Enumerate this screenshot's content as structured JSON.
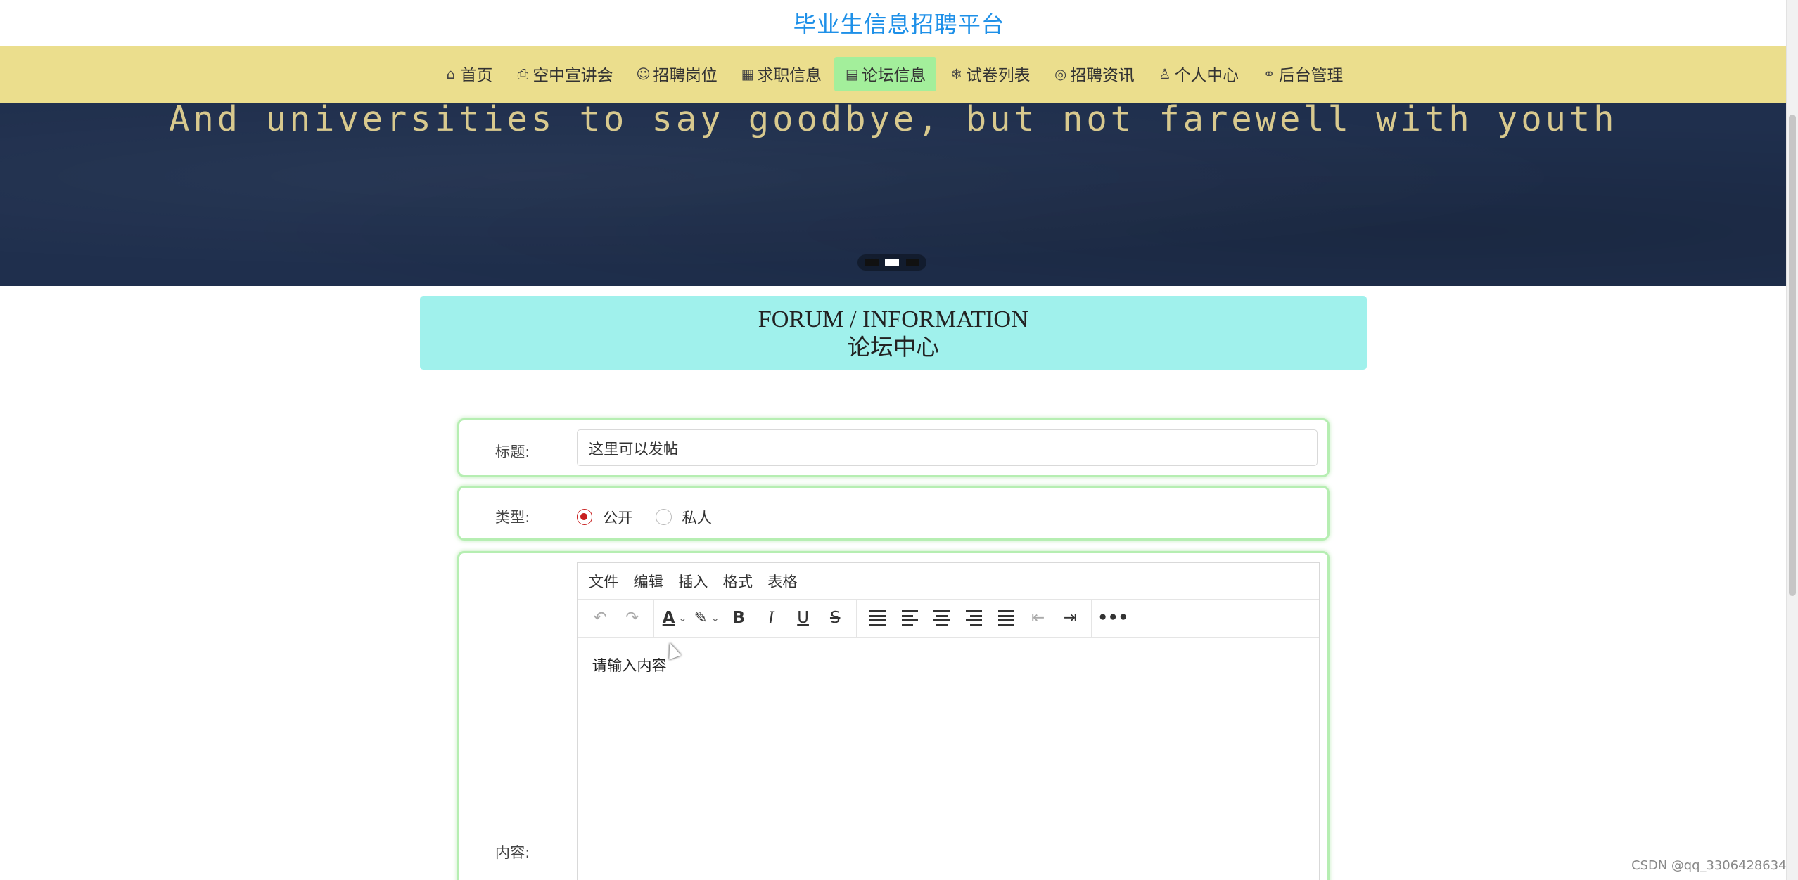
{
  "site": {
    "title": "毕业生信息招聘平台"
  },
  "nav": [
    {
      "icon": "home-icon",
      "glyph": "⌂",
      "label": "首页"
    },
    {
      "icon": "printer-icon",
      "glyph": "⎙",
      "label": "空中宣讲会"
    },
    {
      "icon": "smile-icon",
      "glyph": "☺",
      "label": "招聘岗位"
    },
    {
      "icon": "grid-icon",
      "glyph": "▦",
      "label": "求职信息"
    },
    {
      "icon": "document-icon",
      "glyph": "▤",
      "label": "论坛信息",
      "active": true
    },
    {
      "icon": "snowflake-icon",
      "glyph": "❄",
      "label": "试卷列表"
    },
    {
      "icon": "globe-icon",
      "glyph": "◎",
      "label": "招聘资讯"
    },
    {
      "icon": "user-icon",
      "glyph": "♙",
      "label": "个人中心"
    },
    {
      "icon": "link-icon",
      "glyph": "⚭",
      "label": "后台管理"
    }
  ],
  "banner": {
    "text": "And universities to say goodbye, but not farewell with youth",
    "slides_total": 3,
    "active_slide": 2
  },
  "section": {
    "title_en": "FORUM / INFORMATION",
    "title_cn": "论坛中心"
  },
  "form": {
    "title_label": "标题:",
    "title_value": "这里可以发帖",
    "type_label": "类型:",
    "type_options": [
      "公开",
      "私人"
    ],
    "type_selected": "公开",
    "content_label": "内容:",
    "editor": {
      "menus": [
        "文件",
        "编辑",
        "插入",
        "格式",
        "表格"
      ],
      "placeholder": "请输入内容"
    }
  },
  "colors": {
    "nav_bg": "#ebde8d",
    "active_nav": "#a3ef9b",
    "title_color": "#1e90e8",
    "section_bg": "#a0f1ec",
    "radio_accent": "#c81e1e"
  },
  "watermark": "CSDN @qq_3306428634"
}
